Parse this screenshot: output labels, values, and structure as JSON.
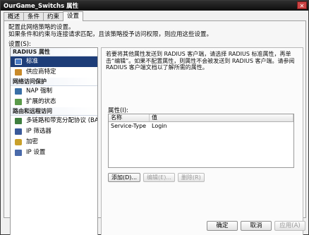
{
  "window": {
    "title": "OurGame_Switchs 属性",
    "close_glyph": "✕"
  },
  "tabs": [
    {
      "label": "概述"
    },
    {
      "label": "条件"
    },
    {
      "label": "约束"
    },
    {
      "label": "设置"
    }
  ],
  "settings": {
    "description_line1": "配置此网络策略的设置。",
    "description_line2": "如果条件和约束与连接请求匹配，且该策略授予访问权限，则应用这些设置。",
    "label": "设置(S):"
  },
  "nav": {
    "groups": [
      {
        "title": "RADIUS 属性",
        "items": [
          {
            "label": "标准",
            "icon": "radius-standard-icon",
            "color": "#4a7bc4",
            "selected": true
          },
          {
            "label": "供应商特定",
            "icon": "vendor-specific-icon",
            "color": "#c98a2a",
            "selected": false
          }
        ]
      },
      {
        "title": "网络访问保护",
        "items": [
          {
            "label": "NAP 强制",
            "icon": "nap-enforcement-icon",
            "color": "#3a6fa6",
            "selected": false
          },
          {
            "label": "扩展的状态",
            "icon": "extended-state-icon",
            "color": "#5a9a4a",
            "selected": false
          }
        ]
      },
      {
        "title": "路由和远程访问",
        "items": [
          {
            "label": "多链路和带宽分配协议 (BAP)",
            "icon": "multilink-icon",
            "color": "#3f7f3f",
            "selected": false
          },
          {
            "label": "IP 筛选器",
            "icon": "ip-filter-icon",
            "color": "#3a5a9a",
            "selected": false
          },
          {
            "label": "加密",
            "icon": "lock-icon",
            "color": "#c9a02a",
            "selected": false
          },
          {
            "label": "IP 设置",
            "icon": "ip-settings-icon",
            "color": "#4a6aaa",
            "selected": false
          }
        ]
      }
    ]
  },
  "content": {
    "description": "若要将其他属性发送到 RADIUS 客户端，请选择 RADIUS 标准属性，再单击“编辑”。如果不配置属性，则属性不会被发送到 RADIUS 客户端。请参阅 RADIUS 客户端文档以了解所需的属性。",
    "attributes_label": "属性(I):",
    "columns": {
      "name": "名称",
      "value": "值"
    },
    "rows": [
      {
        "name": "Service-Type",
        "value": "Login"
      }
    ],
    "buttons": {
      "add": "添加(D)...",
      "edit": "编辑(E)...",
      "remove": "删除(R)"
    }
  },
  "footer": {
    "ok": "确定",
    "cancel": "取消",
    "apply": "应用(A)"
  }
}
